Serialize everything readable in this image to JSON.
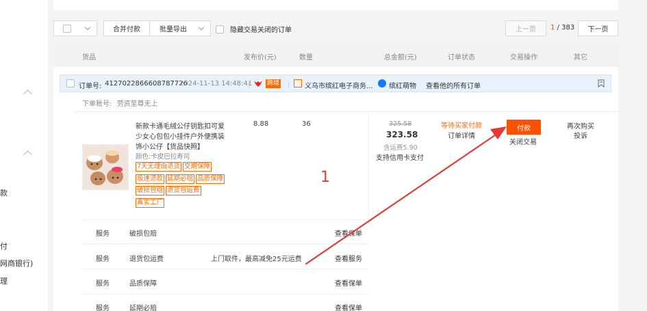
{
  "left_strip": {
    "items": [
      "款",
      "付",
      "网商银行)",
      "理"
    ]
  },
  "toolbar": {
    "merge_pay": "合并付款",
    "batch_export": "批量导出",
    "hide_closed": "隐藏交易关闭的订单",
    "prev_page": "上一页",
    "current_page": "1",
    "total_pages": "/ 383",
    "next_page": "下一页"
  },
  "table_header": {
    "goods": "货品",
    "price": "发布价(元)",
    "quantity": "数量",
    "total": "总金额(元)",
    "status": "订单状态",
    "action": "交易操作",
    "other": "其它"
  },
  "order": {
    "number_label": "订单号:",
    "number": "4127022866608787726",
    "datetime": "2024-11-13 14:48:41",
    "cross_store_badge": "跨境",
    "store_name": "义乌市缤红电子商务...",
    "store_brand": "缤红萌物",
    "view_all": "查看他的所有订单",
    "account_label": "下单账号:",
    "account_name": "劳资至尊无上"
  },
  "product": {
    "title_line1": "新款卡通毛绒公仔钥匙扣可爱",
    "title_line2": "少女心包包小挂件户外便携装",
    "title_line3": "饰小公仔【货品快照】",
    "spec": "颜色:卡皮巴拉寿司",
    "tags": [
      "7天无理由退货",
      "交期保障",
      "极速退款",
      "延期必赔",
      "品质保障",
      "破损包赔",
      "退货包运费",
      "真实工厂"
    ],
    "price": "8.88",
    "quantity": "36"
  },
  "payment": {
    "original_total": "325.58",
    "total": "323.58",
    "shipping": "含运费5.90",
    "credit_card": "支持信用卡支付"
  },
  "status": {
    "waiting": "等待买家付款",
    "details": "订单详情"
  },
  "actions": {
    "pay": "付款",
    "close": "关闭交易"
  },
  "other": {
    "buy_again": "再次购买",
    "complain": "投诉"
  },
  "services": [
    {
      "label": "服务",
      "name": "破损包赔",
      "desc": "",
      "link": "查看保单"
    },
    {
      "label": "服务",
      "name": "退货包运费",
      "desc": "上门取件，最高减免25元运费",
      "link": "查看服务"
    },
    {
      "label": "服务",
      "name": "品质保障",
      "desc": "",
      "link": "查看保单"
    },
    {
      "label": "服务",
      "name": "延期必赔",
      "desc": "",
      "link": "查看保单"
    }
  ],
  "annotation": {
    "number": "1",
    "arrow_color": "#e53935"
  },
  "colors": {
    "accent": "#ff5000",
    "status_orange": "#ff6a00"
  }
}
